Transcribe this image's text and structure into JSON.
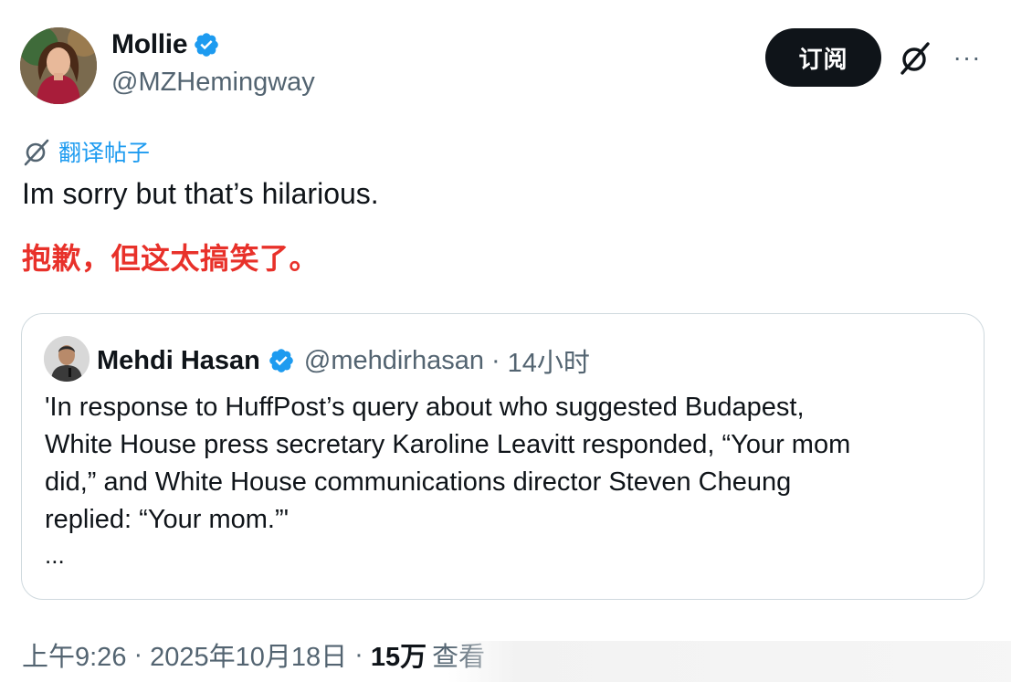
{
  "post": {
    "author_name": "Mollie",
    "author_handle": "@MZHemingway",
    "subscribe_label": "订阅",
    "more_label": "···",
    "translate_label": "翻译帖子",
    "text": "Im sorry but that’s hilarious.",
    "translation": "抱歉，但这太搞笑了。"
  },
  "quote": {
    "author_name": "Mehdi Hasan",
    "author_handle": "@mehdirhasan",
    "separator": "·",
    "time": "14小时",
    "lines": [
      "'In response to HuffPost’s query about who suggested Budapest,",
      "White House press secretary Karoline Leavitt responded, “Your mom",
      "did,” and White House communications director Steven Cheung",
      "replied: “Your mom.”'"
    ],
    "ellipsis": "..."
  },
  "footer": {
    "time": "上午9:26",
    "separator": "·",
    "date": "2025年10月18日",
    "views": "15万",
    "views_label": "查看"
  },
  "colors": {
    "accent_blue": "#1d9bf0",
    "translation_red": "#e8312a",
    "text_dark": "#0f1419",
    "text_secondary": "#536471",
    "border": "#cfd9de"
  },
  "icons": {
    "verified": "verified-badge-icon",
    "grok": "grok-icon",
    "more": "more-icon",
    "translate": "translate-icon"
  }
}
